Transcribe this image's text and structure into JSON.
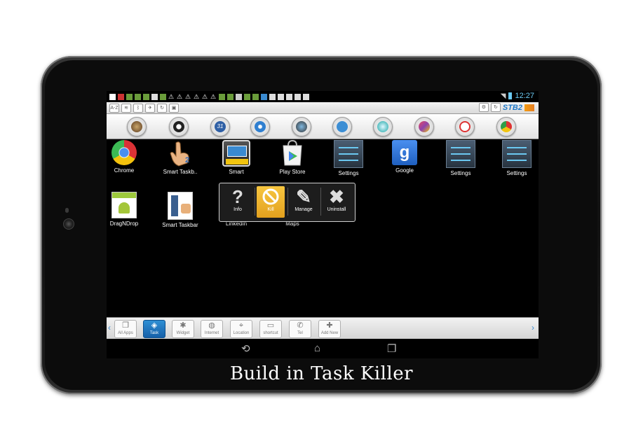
{
  "status_bar": {
    "time": "12:27"
  },
  "toolbar": {
    "az_label": "A-Z",
    "brand_label": "STB2"
  },
  "dock_icons": [
    "photo-icon",
    "settings-knob-icon",
    "calendar-icon",
    "microphone-icon",
    "camera-icon",
    "talk-icon",
    "vpn-icon",
    "gallery-icon",
    "gmail-icon",
    "chrome-icon"
  ],
  "apps": [
    {
      "label": "Chrome"
    },
    {
      "label": "Smart Taskb.."
    },
    {
      "label": "Smart"
    },
    {
      "label": "Play Store"
    },
    {
      "label": "Settings"
    },
    {
      "label": "Google"
    },
    {
      "label": "Settings"
    },
    {
      "label": "Settings"
    },
    {
      "label": "DragNDrop"
    },
    {
      "label": "Smart Taskbar"
    },
    {
      "label": "LinkedIn"
    },
    {
      "label": "Maps"
    }
  ],
  "popup": {
    "info": "Info",
    "kill": "Kill",
    "manage": "Manage",
    "uninstall": "Uninstall",
    "active_item": "Kill"
  },
  "taskbar": {
    "items": [
      {
        "label": "All Apps"
      },
      {
        "label": "Task"
      },
      {
        "label": "Widget"
      },
      {
        "label": "Internet"
      },
      {
        "label": "Location"
      },
      {
        "label": "shortcut"
      },
      {
        "label": "Tel"
      },
      {
        "label": "Add New"
      }
    ],
    "active_item": "Task"
  },
  "caption": "Build in Task Killer",
  "colors": {
    "accent": "#1f78c8",
    "kill_highlight": "#f0b42e",
    "bezel": "#111111"
  }
}
